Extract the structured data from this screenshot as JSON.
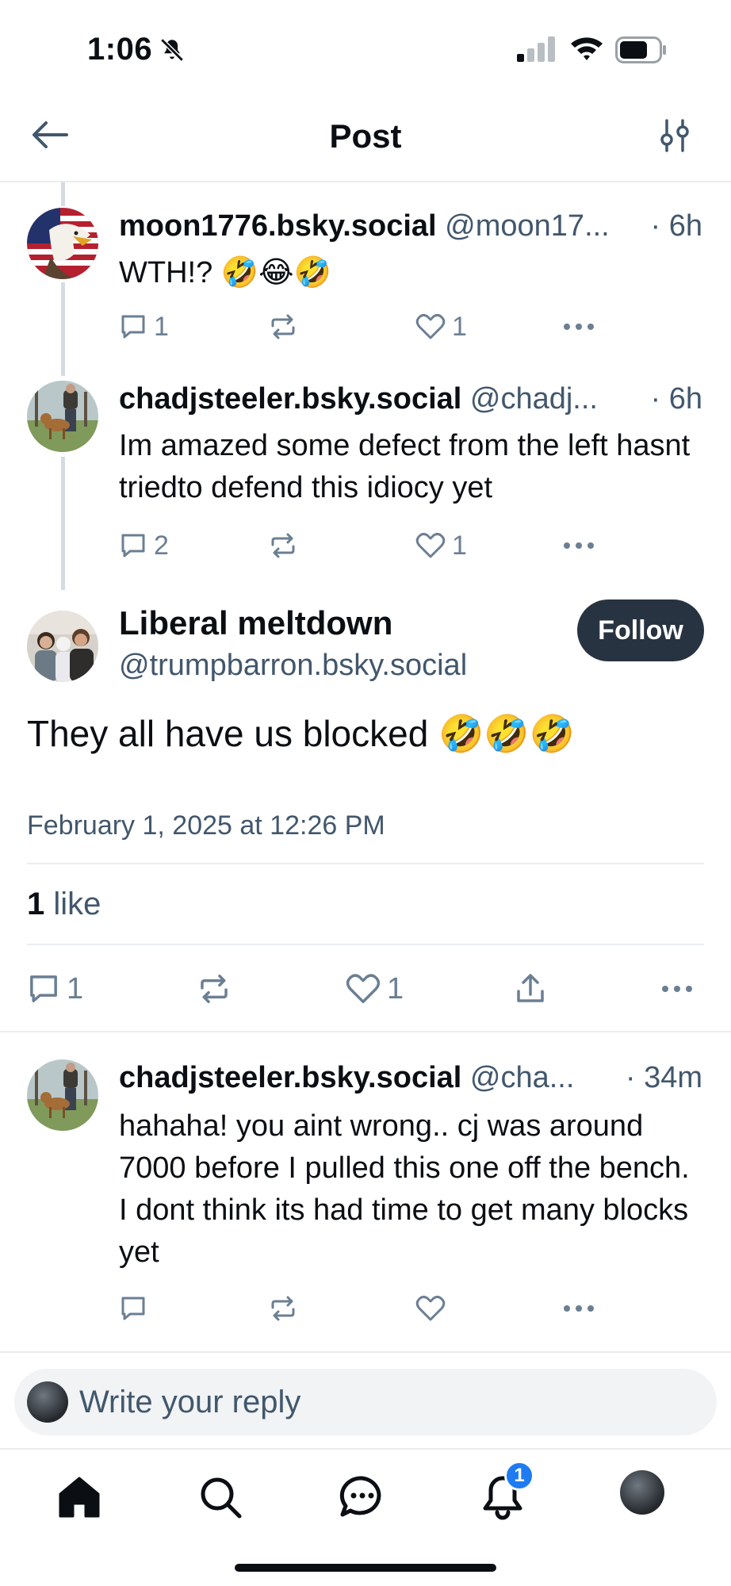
{
  "status_bar": {
    "time": "1:06"
  },
  "header": {
    "title": "Post"
  },
  "thread": [
    {
      "name": "moon1776.bsky.social",
      "handle": "@moon17...",
      "time": "· 6h",
      "text": "WTH!? 🤣😂🤣",
      "replies": "1",
      "reposts": "",
      "likes": "1"
    },
    {
      "name": "chadjsteeler.bsky.social",
      "handle": "@chadj...",
      "time": "· 6h",
      "text": "Im amazed some defect from the left hasnt triedto defend this idiocy yet",
      "replies": "2",
      "reposts": "",
      "likes": "1"
    }
  ],
  "main_post": {
    "name": "Liberal meltdown",
    "handle": "@trumpbarron.bsky.social",
    "follow_label": "Follow",
    "text": "They all have us blocked 🤣🤣🤣",
    "date": "February 1, 2025 at 12:26 PM",
    "like_count": "1",
    "like_label": "like",
    "replies": "1",
    "likes": "1"
  },
  "reply": {
    "name": "chadjsteeler.bsky.social",
    "handle": "@cha...",
    "time": "· 34m",
    "text": "hahaha! you aint wrong.. cj was around 7000 before I pulled this one off the bench. I dont think its had time to get many blocks yet"
  },
  "composer": {
    "placeholder": "Write your reply"
  },
  "tab_bar": {
    "notification_badge": "1"
  },
  "colors": {
    "accent": "#1f7bf2",
    "follow_button": "#283341",
    "muted_text": "#42576c",
    "icon": "#6b7f93"
  }
}
